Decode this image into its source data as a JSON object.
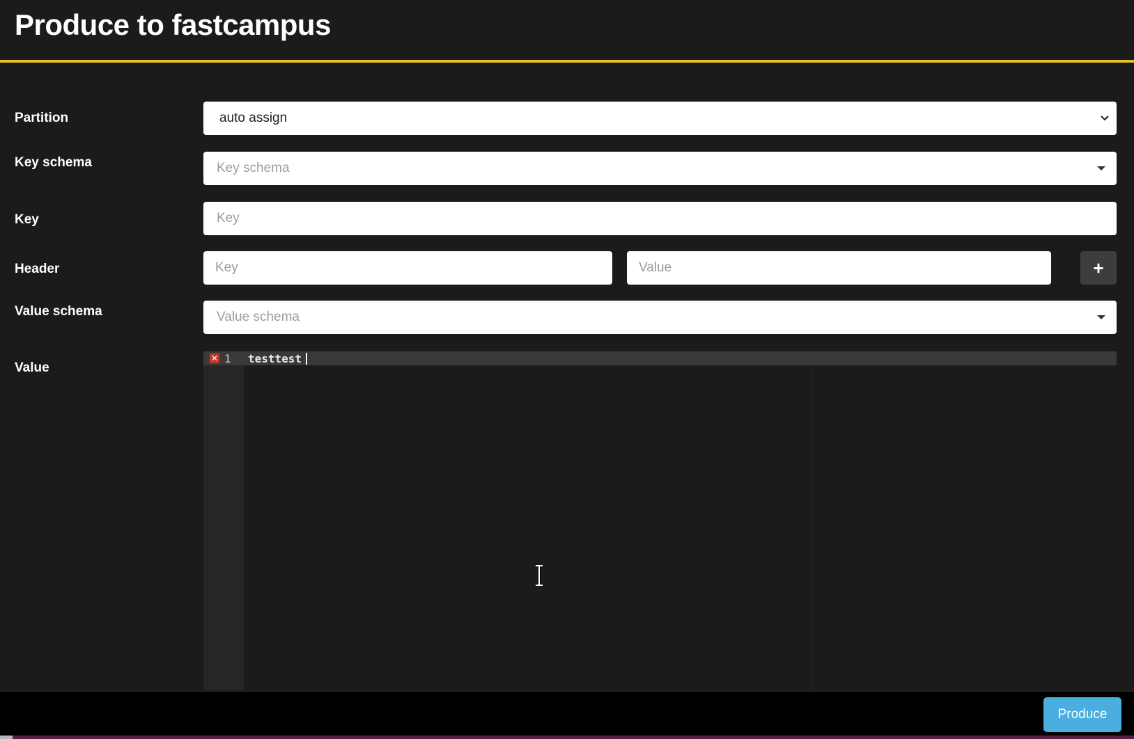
{
  "header": {
    "title": "Produce to fastcampus"
  },
  "form": {
    "partition": {
      "label": "Partition",
      "value": "auto assign"
    },
    "key_schema": {
      "label": "Key schema",
      "placeholder": "Key schema"
    },
    "key": {
      "label": "Key",
      "placeholder": "Key"
    },
    "header": {
      "label": "Header",
      "key_placeholder": "Key",
      "value_placeholder": "Value",
      "add_label": "+"
    },
    "value_schema": {
      "label": "Value schema",
      "placeholder": "Value schema"
    },
    "value": {
      "label": "Value",
      "editor": {
        "line_number": "1",
        "content": "testtest",
        "error_marker": "✕"
      }
    }
  },
  "footer": {
    "produce_label": "Produce"
  },
  "colors": {
    "accent_underline": "#e8bf2a",
    "produce_button": "#4aaee0",
    "error_marker": "#c0392b"
  }
}
